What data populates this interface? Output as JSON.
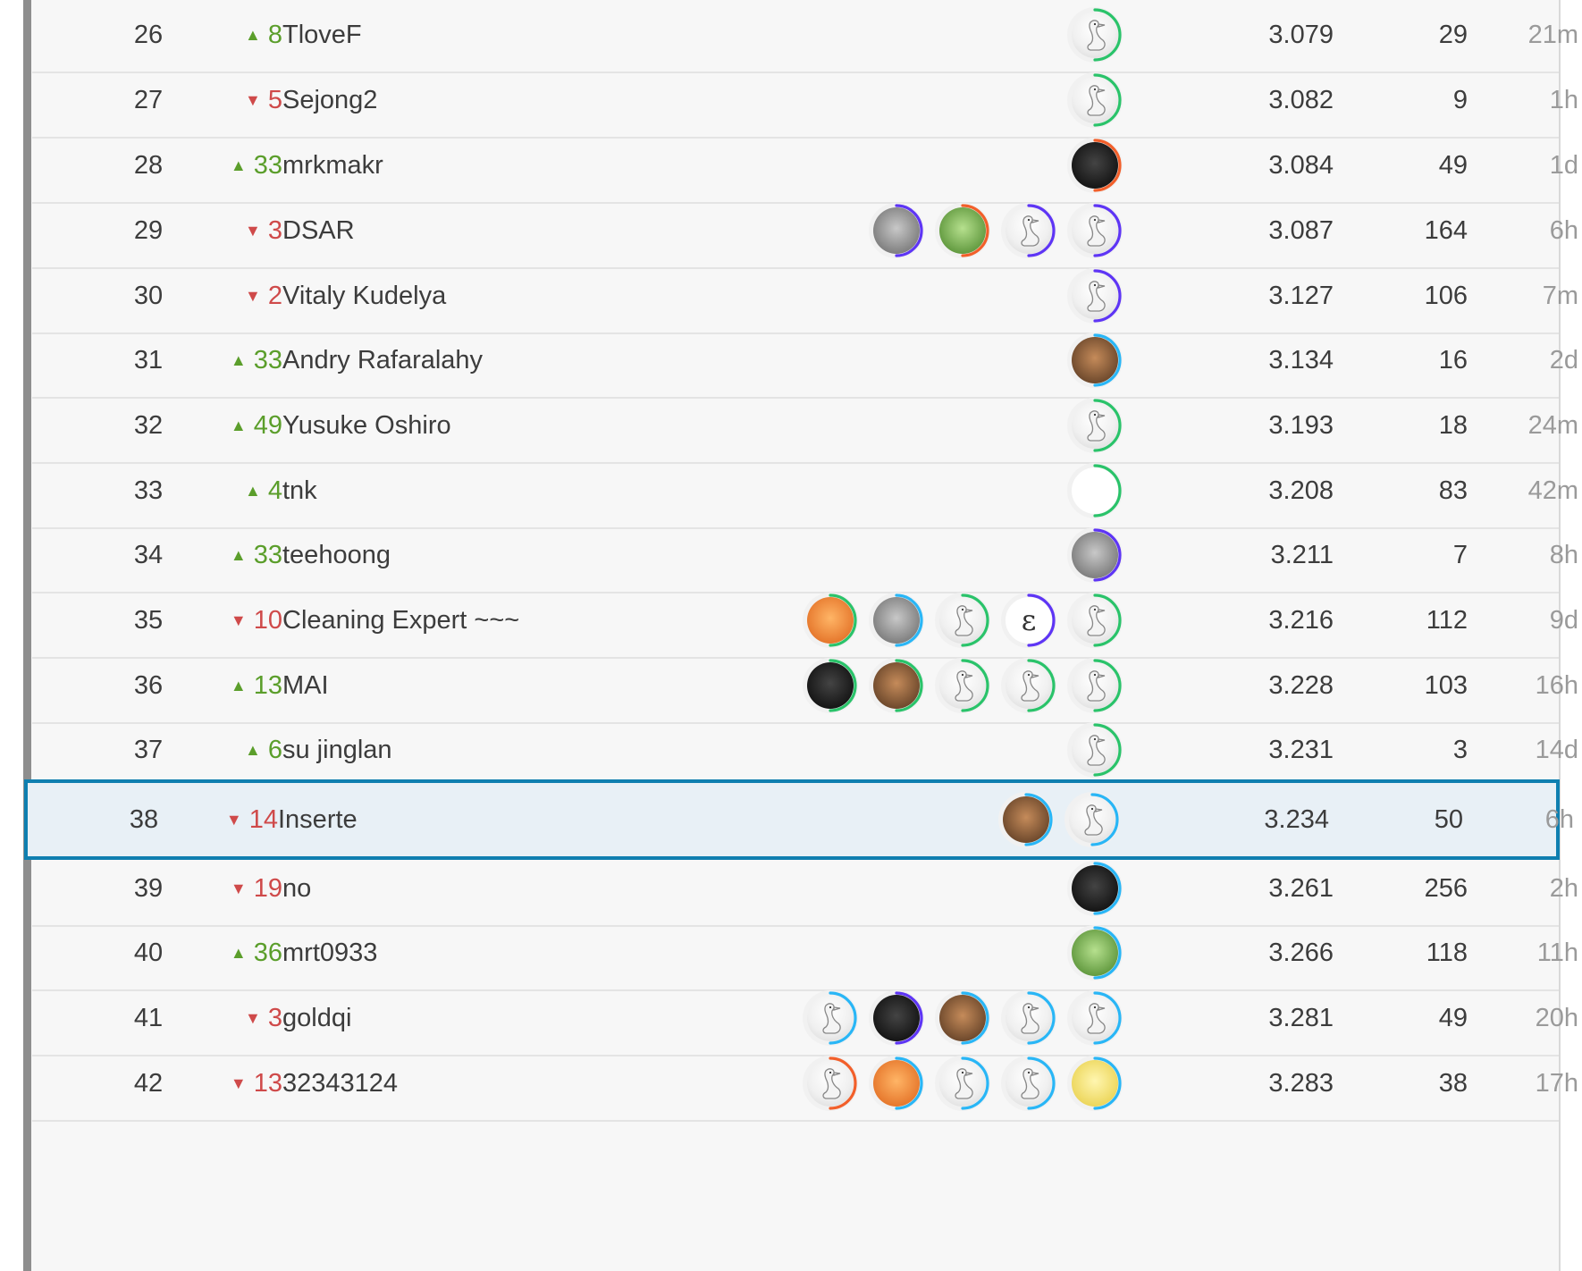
{
  "leaderboard": {
    "tier_colors": {
      "green": "#20beff",
      "teal": "#2ac36a",
      "blue": "#29b6f6",
      "purple": "#5e35f5",
      "orange": "#f25f2a"
    },
    "rows": [
      {
        "rank": "26",
        "direction": "up",
        "change": "8",
        "team": "TloveF",
        "score": "3.079",
        "entries": "29",
        "last": "21m",
        "members": [
          {
            "avatar": "goose-icon",
            "tier": "teal"
          }
        ]
      },
      {
        "rank": "27",
        "direction": "down",
        "change": "5",
        "team": "Sejong2",
        "score": "3.082",
        "entries": "9",
        "last": "1h",
        "members": [
          {
            "avatar": "goose-icon",
            "tier": "teal"
          }
        ]
      },
      {
        "rank": "28",
        "direction": "up",
        "change": "33",
        "team": "mrkmakr",
        "score": "3.084",
        "entries": "49",
        "last": "1d",
        "members": [
          {
            "avatar": "user-photo",
            "tier": "orange",
            "style": "dark"
          }
        ]
      },
      {
        "rank": "29",
        "direction": "down",
        "change": "3",
        "team": "DSAR",
        "score": "3.087",
        "entries": "164",
        "last": "6h",
        "members": [
          {
            "avatar": "goose-icon",
            "tier": "purple"
          },
          {
            "avatar": "goose-icon",
            "tier": "purple"
          },
          {
            "avatar": "user-photo",
            "tier": "orange",
            "style": "green"
          },
          {
            "avatar": "user-photo",
            "tier": "purple",
            "style": "gray"
          }
        ]
      },
      {
        "rank": "30",
        "direction": "down",
        "change": "2",
        "team": "Vitaly Kudelya",
        "score": "3.127",
        "entries": "106",
        "last": "7m",
        "members": [
          {
            "avatar": "goose-icon",
            "tier": "purple"
          }
        ]
      },
      {
        "rank": "31",
        "direction": "up",
        "change": "33",
        "team": "Andry Rafaralahy",
        "score": "3.134",
        "entries": "16",
        "last": "2d",
        "members": [
          {
            "avatar": "user-photo",
            "tier": "blue",
            "style": "warm"
          }
        ]
      },
      {
        "rank": "32",
        "direction": "up",
        "change": "49",
        "team": "Yusuke Oshiro",
        "score": "3.193",
        "entries": "18",
        "last": "24m",
        "members": [
          {
            "avatar": "goose-icon",
            "tier": "teal"
          }
        ]
      },
      {
        "rank": "33",
        "direction": "up",
        "change": "4",
        "team": "tnk",
        "score": "3.208",
        "entries": "83",
        "last": "42m",
        "members": [
          {
            "avatar": "user-photo",
            "tier": "teal",
            "style": "white"
          }
        ]
      },
      {
        "rank": "34",
        "direction": "up",
        "change": "33",
        "team": "teehoong",
        "score": "3.211",
        "entries": "7",
        "last": "8h",
        "members": [
          {
            "avatar": "user-photo",
            "tier": "purple",
            "style": "gray"
          }
        ]
      },
      {
        "rank": "35",
        "direction": "down",
        "change": "10",
        "team": "Cleaning Expert ~~~",
        "score": "3.216",
        "entries": "112",
        "last": "9d",
        "members": [
          {
            "avatar": "goose-icon",
            "tier": "teal"
          },
          {
            "avatar": "epsilon-icon",
            "tier": "purple"
          },
          {
            "avatar": "goose-icon",
            "tier": "teal"
          },
          {
            "avatar": "user-photo",
            "tier": "blue",
            "style": "gray"
          },
          {
            "avatar": "user-photo",
            "tier": "teal",
            "style": "orange"
          }
        ]
      },
      {
        "rank": "36",
        "direction": "up",
        "change": "13",
        "team": "MAI",
        "score": "3.228",
        "entries": "103",
        "last": "16h",
        "members": [
          {
            "avatar": "goose-icon",
            "tier": "teal"
          },
          {
            "avatar": "goose-icon",
            "tier": "teal"
          },
          {
            "avatar": "goose-icon",
            "tier": "teal"
          },
          {
            "avatar": "user-photo",
            "tier": "teal",
            "style": "warm"
          },
          {
            "avatar": "user-photo",
            "tier": "teal",
            "style": "dark"
          }
        ]
      },
      {
        "rank": "37",
        "direction": "up",
        "change": "6",
        "team": "su jinglan",
        "score": "3.231",
        "entries": "3",
        "last": "14d",
        "members": [
          {
            "avatar": "goose-icon",
            "tier": "teal"
          }
        ]
      },
      {
        "rank": "38",
        "direction": "down",
        "change": "14",
        "team": "Inserte",
        "score": "3.234",
        "entries": "50",
        "last": "6h",
        "highlight": true,
        "members": [
          {
            "avatar": "goose-icon",
            "tier": "blue"
          },
          {
            "avatar": "user-photo",
            "tier": "blue",
            "style": "warm"
          }
        ]
      },
      {
        "rank": "39",
        "direction": "down",
        "change": "19",
        "team": "no",
        "score": "3.261",
        "entries": "256",
        "last": "2h",
        "members": [
          {
            "avatar": "user-photo",
            "tier": "blue",
            "style": "dark"
          }
        ]
      },
      {
        "rank": "40",
        "direction": "up",
        "change": "36",
        "team": "mrt0933",
        "score": "3.266",
        "entries": "118",
        "last": "11h",
        "members": [
          {
            "avatar": "user-photo",
            "tier": "blue",
            "style": "green"
          }
        ]
      },
      {
        "rank": "41",
        "direction": "down",
        "change": "3",
        "team": "goldqi",
        "score": "3.281",
        "entries": "49",
        "last": "20h",
        "members": [
          {
            "avatar": "goose-icon",
            "tier": "blue"
          },
          {
            "avatar": "goose-icon",
            "tier": "blue"
          },
          {
            "avatar": "user-photo",
            "tier": "blue",
            "style": "warm"
          },
          {
            "avatar": "user-photo",
            "tier": "purple",
            "style": "dark"
          },
          {
            "avatar": "goose-icon",
            "tier": "blue"
          }
        ]
      },
      {
        "rank": "42",
        "direction": "down",
        "change": "13",
        "team": "32343124",
        "score": "3.283",
        "entries": "38",
        "last": "17h",
        "members": [
          {
            "avatar": "user-photo",
            "tier": "blue",
            "style": "yellow"
          },
          {
            "avatar": "goose-icon",
            "tier": "blue"
          },
          {
            "avatar": "goose-icon",
            "tier": "blue"
          },
          {
            "avatar": "user-photo",
            "tier": "blue",
            "style": "orange"
          },
          {
            "avatar": "goose-icon",
            "tier": "orange"
          }
        ]
      }
    ]
  }
}
